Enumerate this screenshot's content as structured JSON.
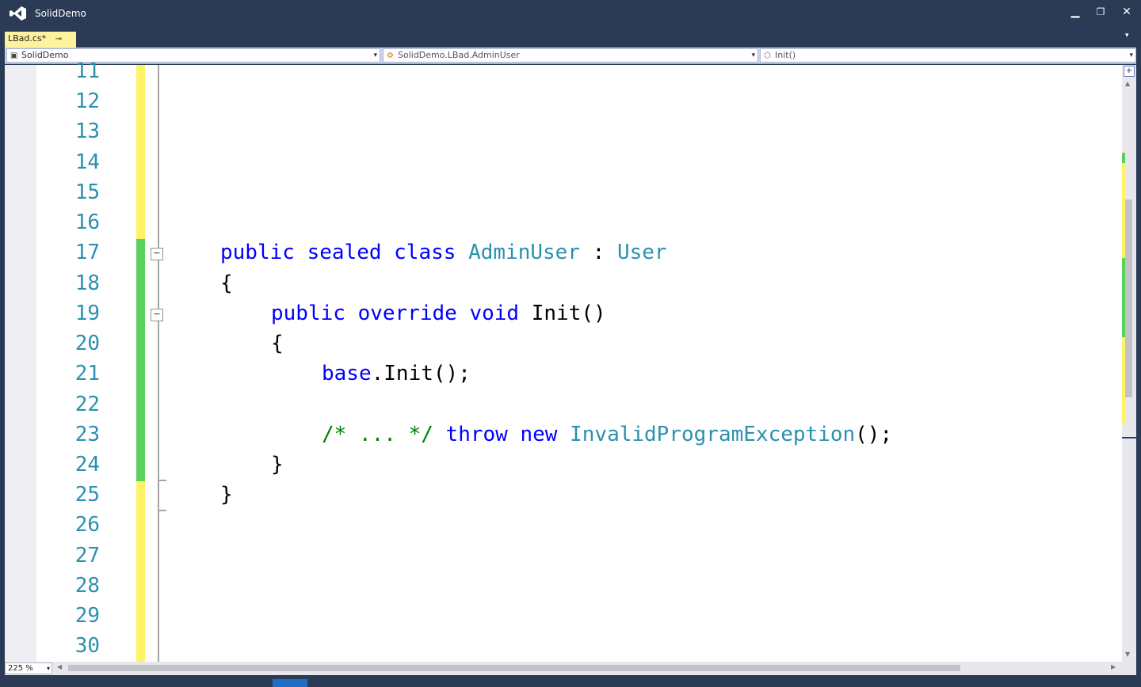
{
  "window": {
    "title": "SolidDemo"
  },
  "tab": {
    "label": "LBad.cs*",
    "pin": "⊸",
    "close": "✕"
  },
  "navbar": {
    "project": "SolidDemo",
    "type": "SolidDemo.LBad.AdminUser",
    "member": "Init()"
  },
  "zoom": "225 %",
  "line_numbers": [
    "11",
    "12",
    "13",
    "14",
    "15",
    "16",
    "17",
    "18",
    "19",
    "20",
    "21",
    "22",
    "23",
    "24",
    "25",
    "26",
    "27",
    "28",
    "29",
    "30"
  ],
  "code": {
    "l17": {
      "kw1": "public",
      "kw2": "sealed",
      "kw3": "class",
      "name": "AdminUser",
      "sep": " : ",
      "base": "User"
    },
    "l18": "{",
    "l19": {
      "kw1": "public",
      "kw2": "override",
      "kw3": "void",
      "rest": "Init()"
    },
    "l20": "{",
    "l21": {
      "kw": "base",
      "rest": ".Init();"
    },
    "l23": {
      "comment": "/* ... */",
      "kw1": "throw",
      "kw2": "new",
      "type": "InvalidProgramException",
      "rest": "();"
    },
    "l24": "}",
    "l25": "}"
  },
  "colors": {
    "keyword": "#0000ff",
    "type": "#2b91af",
    "comment": "#008000",
    "saved_change": "#5ad25a",
    "unsaved_change": "#fff266"
  }
}
